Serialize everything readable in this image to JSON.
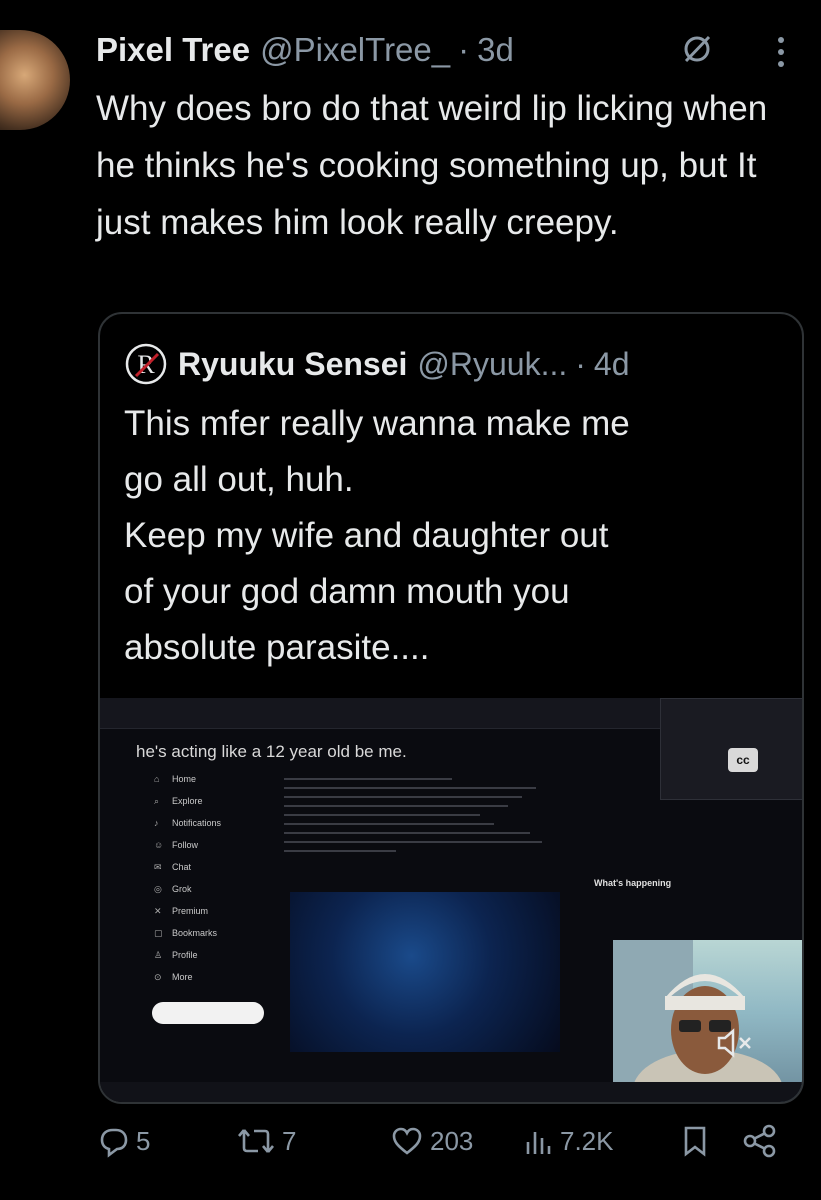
{
  "post": {
    "author_name": "Pixel Tree",
    "author_handle": "@PixelTree_",
    "separator": "·",
    "time": "3d",
    "text": "Why does bro do that weird lip licking when he thinks he's cooking something up, but It just makes him look really creepy.",
    "icons": [
      "grok-icon",
      "more-icon"
    ]
  },
  "quote": {
    "author_name": "Ryuuku Sensei",
    "author_handle": "@Ryuuk...",
    "separator": "·",
    "time": "4d",
    "text_lines": [
      "This mfer really wanna make me",
      "go all out, huh.",
      "Keep my wife and daughter out",
      "of your god damn mouth you",
      "absolute parasite...."
    ],
    "media": {
      "caption": "he's acting like a 12 year old be me.",
      "nav_items": [
        "Home",
        "Explore",
        "Notifications",
        "Follow",
        "Chat",
        "Grok",
        "Premium",
        "Bookmarks",
        "Profile",
        "More"
      ],
      "section_title": "What's happening",
      "cc_label": "cc"
    }
  },
  "actions": {
    "replies": "5",
    "reposts": "7",
    "likes": "203",
    "views": "7.2K"
  }
}
